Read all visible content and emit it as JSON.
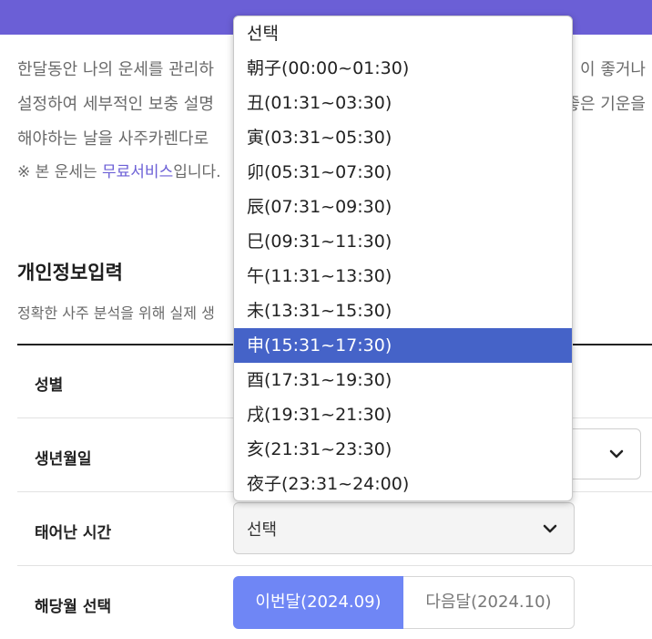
{
  "intro": {
    "line1_left": "한달동안 나의 운세를 관리하",
    "line1_right": "이 좋거나",
    "line2_left": "설정하여 세부적인 보충 설명",
    "line2_right": "좋은 기운을",
    "line3_left": "해야하는 날을 사주카렌다로"
  },
  "note": {
    "prefix": "※ 본 운세는 ",
    "link": "무료서비스",
    "suffix": "입니다."
  },
  "section": {
    "title": "개인정보입력",
    "desc": "정확한 사주 분석을 위해 실제 생"
  },
  "form": {
    "gender_label": "성별",
    "birth_label": "생년월일",
    "time_label": "태어난 시간",
    "time_value": "선택",
    "month_label": "해당월 선택",
    "month_current": "이번달(2024.09)",
    "month_next": "다음달(2024.10)"
  },
  "dropdown": {
    "options": [
      "선택",
      "朝子(00:00~01:30)",
      "丑(01:31~03:30)",
      "寅(03:31~05:30)",
      "卯(05:31~07:30)",
      "辰(07:31~09:30)",
      "巳(09:31~11:30)",
      "午(11:31~13:30)",
      "未(13:31~15:30)",
      "申(15:31~17:30)",
      "酉(17:31~19:30)",
      "戌(19:31~21:30)",
      "亥(21:31~23:30)",
      "夜子(23:31~24:00)"
    ],
    "highlighted_option": "申(15:31~17:30)"
  },
  "colors": {
    "top_bar": "#6b5fd6",
    "link": "#6b5fd6",
    "highlight": "#4563c8",
    "segment_active": "#6f86f5"
  },
  "icons": {
    "select_arrow": "chevron-down-icon"
  }
}
